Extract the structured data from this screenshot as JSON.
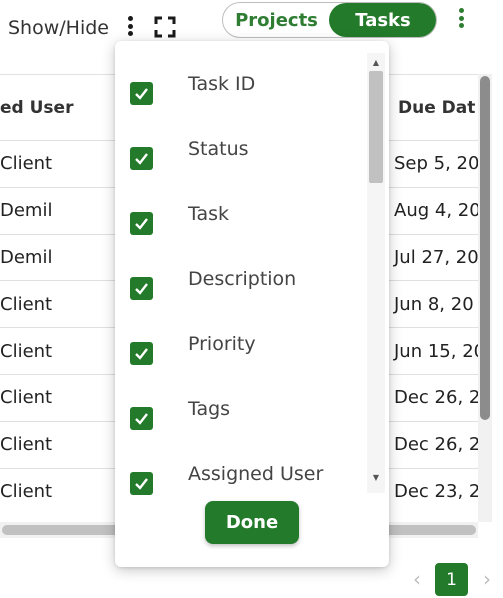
{
  "toolbar": {
    "show_hide_label": "Show/Hide",
    "more_icon": "vertical-dots-icon",
    "fullscreen_icon": "fullscreen-icon",
    "view_toggle": {
      "projects_label": "Projects",
      "tasks_label": "Tasks",
      "selected": "Tasks"
    },
    "menu_icon": "vertical-dots-icon"
  },
  "table": {
    "headers": {
      "assigned_user": "ed User",
      "due_date": "Due Dat"
    },
    "rows": [
      {
        "assigned_user": "Client",
        "due_date": "Sep 5, 20"
      },
      {
        "assigned_user": "Demil",
        "due_date": "Aug 4, 20"
      },
      {
        "assigned_user": "Demil",
        "due_date": "Jul 27, 20"
      },
      {
        "assigned_user": "Client",
        "due_date": "Jun 8, 20"
      },
      {
        "assigned_user": "Client",
        "due_date": "Jun 15, 20"
      },
      {
        "assigned_user": "Client",
        "due_date": "Dec 26, 2"
      },
      {
        "assigned_user": "Client",
        "due_date": "Dec 26, 2"
      },
      {
        "assigned_user": "Client",
        "due_date": "Dec 23, 2"
      }
    ]
  },
  "column_panel": {
    "items": [
      {
        "label": "Task ID",
        "checked": true
      },
      {
        "label": "Status",
        "checked": true
      },
      {
        "label": "Task",
        "checked": true
      },
      {
        "label": "Description",
        "checked": true
      },
      {
        "label": "Priority",
        "checked": true
      },
      {
        "label": "Tags",
        "checked": true
      },
      {
        "label": "Assigned User",
        "checked": true
      }
    ],
    "done_label": "Done"
  },
  "pagination": {
    "current_page": "1",
    "prev_icon": "chevron-left-icon",
    "next_icon": "chevron-right-icon"
  },
  "colors": {
    "accent": "#237a2a",
    "accent_text": "#2e7d32",
    "disabled": "#bdbdbd"
  }
}
